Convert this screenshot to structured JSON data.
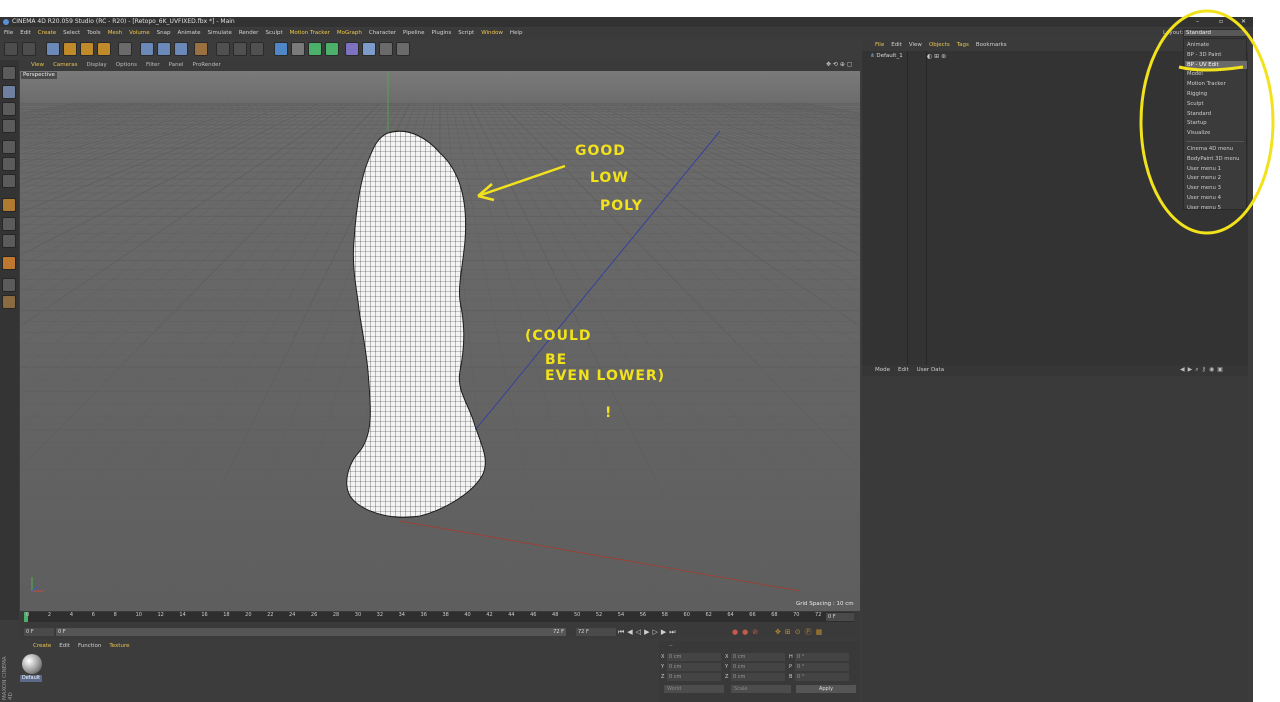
{
  "window": {
    "title": "CINEMA 4D R20.059 Studio (RC - R20) - [Retopo_6K_UVFIXED.fbx *] - Main",
    "controls": [
      "–",
      "▫",
      "✕"
    ]
  },
  "menubar": {
    "items": [
      "File",
      "Edit",
      "Create",
      "Select",
      "Tools",
      "Mesh",
      "Volume",
      "Snap",
      "Animate",
      "Simulate",
      "Render",
      "Sculpt",
      "Motion Tracker",
      "MoGraph",
      "Character",
      "Pipeline",
      "Plugins",
      "Script",
      "Window",
      "Help"
    ],
    "highlighted": [
      "Create",
      "Mesh",
      "Volume",
      "Motion Tracker",
      "MoGraph",
      "Window"
    ]
  },
  "viewport": {
    "menu": [
      "View",
      "Cameras",
      "Display",
      "Options",
      "Filter",
      "Panel",
      "ProRender"
    ],
    "menu_highlighted": [
      "View",
      "Cameras"
    ],
    "label": "Perspective",
    "grid_spacing": "Grid Spacing : 10 cm"
  },
  "timeline": {
    "ticks": [
      "0",
      "2",
      "4",
      "6",
      "8",
      "10",
      "12",
      "14",
      "16",
      "18",
      "20",
      "22",
      "24",
      "26",
      "28",
      "30",
      "32",
      "34",
      "36",
      "38",
      "40",
      "42",
      "44",
      "46",
      "48",
      "50",
      "52",
      "54",
      "56",
      "58",
      "60",
      "62",
      "64",
      "66",
      "68",
      "70",
      "72"
    ],
    "end_frame": "0 F",
    "start_field": "0 F",
    "min_field": "0 F",
    "max_field": "72 F",
    "end_field": "72 F"
  },
  "material_manager": {
    "menu": [
      "Create",
      "Edit",
      "Function",
      "Texture"
    ],
    "menu_highlighted": [
      "Create",
      "Texture"
    ],
    "material_name": "Default",
    "brand": "MAXON CINEMA 4D"
  },
  "coordinates": {
    "dashes": "--",
    "rows": [
      {
        "a": "X",
        "av": "0 cm",
        "b": "X",
        "bv": "0 cm",
        "c": "H",
        "cv": "0 °"
      },
      {
        "a": "Y",
        "av": "0 cm",
        "b": "Y",
        "bv": "0 cm",
        "c": "P",
        "cv": "0 °"
      },
      {
        "a": "Z",
        "av": "0 cm",
        "b": "Z",
        "bv": "0 cm",
        "c": "B",
        "cv": "0 °"
      }
    ],
    "world": "World",
    "scale": "Scale",
    "apply": "Apply"
  },
  "object_manager": {
    "menu": [
      "File",
      "Edit",
      "View",
      "Objects",
      "Tags",
      "Bookmarks"
    ],
    "menu_highlighted": [
      "File",
      "Objects",
      "Tags"
    ],
    "object": "Default_1"
  },
  "attribute_manager": {
    "menu": [
      "Mode",
      "Edit",
      "User Data"
    ]
  },
  "layout": {
    "label": "Layout:",
    "selected": "Standard",
    "items": [
      "Animate",
      "BP - 3D Paint",
      "BP - UV Edit",
      "Model",
      "Motion Tracker",
      "Rigging",
      "Sculpt",
      "Standard",
      "Startup",
      "Visualize"
    ],
    "items2": [
      "Cinema 4D menu",
      "BodyPaint 3D menu",
      "User menu 1",
      "User menu 2",
      "User menu 3",
      "User menu 4",
      "User menu 5"
    ],
    "hovered": "BP - UV Edit"
  },
  "annotations": {
    "good1": "GOOD",
    "good2": "LOW",
    "good3": "POLY",
    "could1": "(COULD",
    "could2": "BE",
    "could3": "EVEN LOWER)",
    "could4": "!"
  },
  "colors": {
    "annotation": "#f2e21c",
    "accent": "#e8c552",
    "viewport_bg": "#6d6d6d"
  }
}
